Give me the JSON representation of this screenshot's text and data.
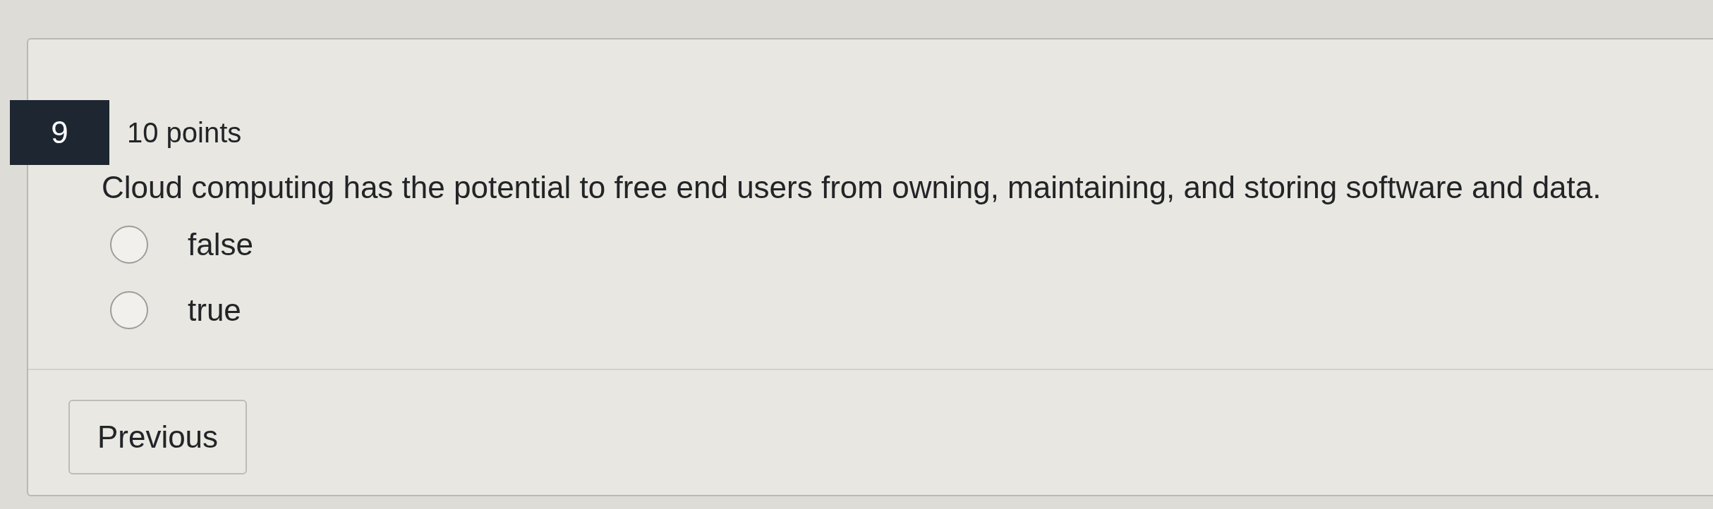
{
  "question": {
    "number": "9",
    "points": "10 points",
    "text": "Cloud computing has the potential to free end users from owning, maintaining, and storing software and data.",
    "options": [
      {
        "label": "false",
        "selected": false
      },
      {
        "label": "true",
        "selected": false
      }
    ]
  },
  "buttons": [
    {
      "label": "Previous"
    }
  ]
}
